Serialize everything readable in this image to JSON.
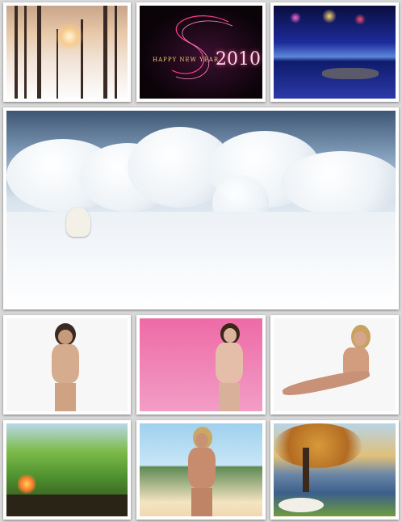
{
  "tiles": [
    {
      "label": "winter forest path"
    },
    {
      "label": "new year 2010"
    },
    {
      "label": "fireworks over lake"
    },
    {
      "label": "polar bear in clouds"
    },
    {
      "label": "model white background"
    },
    {
      "label": "model pink background"
    },
    {
      "label": "model sitting white background"
    },
    {
      "label": "forest campfire"
    },
    {
      "label": "model beach"
    },
    {
      "label": "autumn tree lake"
    }
  ],
  "newyear": {
    "greeting": "HAPPY NEW YEAR",
    "year": "2010"
  }
}
